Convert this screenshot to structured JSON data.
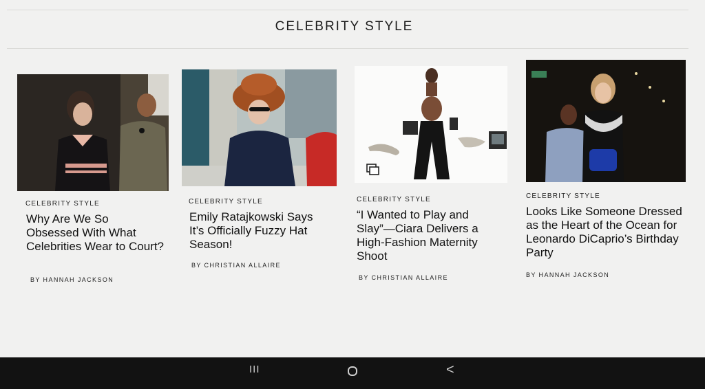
{
  "section": {
    "title": "CELEBRITY STYLE"
  },
  "articles": [
    {
      "kicker": "CELEBRITY STYLE",
      "headline": "Why Are We So Obsessed With What Celebrities Wear to Court?",
      "byline": "BY HANNAH JACKSON",
      "image_desc": "photo-courtroom"
    },
    {
      "kicker": "CELEBRITY STYLE",
      "headline": "Emily Ratajkowski Says It’s Officially Fuzzy Hat Season!",
      "byline": "BY CHRISTIAN ALLAIRE",
      "image_desc": "photo-fuzzy-hat-street"
    },
    {
      "kicker": "CELEBRITY STYLE",
      "headline": "“I Wanted to Play and Slay”—Ciara Delivers a High-Fashion Maternity Shoot",
      "byline": "BY CHRISTIAN ALLAIRE",
      "image_desc": "photo-maternity-shoot",
      "gallery_icon": "gallery-icon"
    },
    {
      "kicker": "CELEBRITY STYLE",
      "headline": "Looks Like Someone Dressed as the Heart of the Ocean for Leonardo DiCaprio’s Birthday Party",
      "byline": "BY HANNAH JACKSON",
      "image_desc": "photo-birthday-party"
    }
  ],
  "navigation_bar": {
    "recents": "III",
    "home": "O",
    "back": "<"
  },
  "colors": {
    "background": "#f1f1f0",
    "text": "#111111",
    "nav": "#121212"
  }
}
